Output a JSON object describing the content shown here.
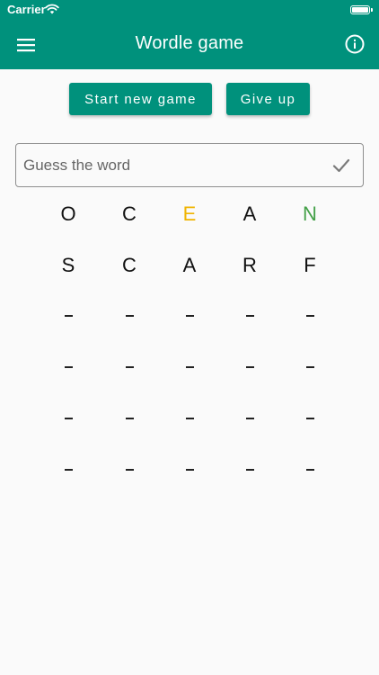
{
  "status_bar": {
    "carrier": "Carrier"
  },
  "app_bar": {
    "title": "Wordle game"
  },
  "buttons": {
    "start_new_game": "Start new game",
    "give_up": "Give up"
  },
  "guess_input": {
    "placeholder": "Guess the word",
    "value": ""
  },
  "icons": {
    "menu": "hamburger-menu-icon",
    "info": "info-circle-icon",
    "submit": "checkmark-icon",
    "wifi": "wifi-icon",
    "battery": "battery-icon"
  },
  "colors": {
    "primary": "#00917c",
    "present": "#f0b400",
    "correct": "#43a047",
    "letter": "#111111",
    "background": "#fafafa"
  },
  "board": {
    "rows": [
      {
        "letters": [
          {
            "char": "O",
            "state": "absent"
          },
          {
            "char": "C",
            "state": "absent"
          },
          {
            "char": "E",
            "state": "present"
          },
          {
            "char": "A",
            "state": "absent"
          },
          {
            "char": "N",
            "state": "correct"
          }
        ]
      },
      {
        "letters": [
          {
            "char": "S",
            "state": "absent"
          },
          {
            "char": "C",
            "state": "absent"
          },
          {
            "char": "A",
            "state": "absent"
          },
          {
            "char": "R",
            "state": "absent"
          },
          {
            "char": "F",
            "state": "absent"
          }
        ]
      },
      {
        "letters": [
          {
            "char": "",
            "state": "empty"
          },
          {
            "char": "",
            "state": "empty"
          },
          {
            "char": "",
            "state": "empty"
          },
          {
            "char": "",
            "state": "empty"
          },
          {
            "char": "",
            "state": "empty"
          }
        ]
      },
      {
        "letters": [
          {
            "char": "",
            "state": "empty"
          },
          {
            "char": "",
            "state": "empty"
          },
          {
            "char": "",
            "state": "empty"
          },
          {
            "char": "",
            "state": "empty"
          },
          {
            "char": "",
            "state": "empty"
          }
        ]
      },
      {
        "letters": [
          {
            "char": "",
            "state": "empty"
          },
          {
            "char": "",
            "state": "empty"
          },
          {
            "char": "",
            "state": "empty"
          },
          {
            "char": "",
            "state": "empty"
          },
          {
            "char": "",
            "state": "empty"
          }
        ]
      },
      {
        "letters": [
          {
            "char": "",
            "state": "empty"
          },
          {
            "char": "",
            "state": "empty"
          },
          {
            "char": "",
            "state": "empty"
          },
          {
            "char": "",
            "state": "empty"
          },
          {
            "char": "",
            "state": "empty"
          }
        ]
      }
    ]
  }
}
